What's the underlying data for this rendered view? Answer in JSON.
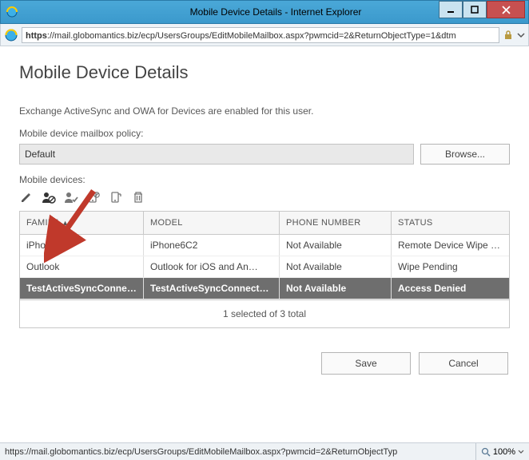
{
  "window": {
    "title": "Mobile Device Details - Internet Explorer",
    "url_display": "https://mail.globomantics.biz/ecp/UsersGroups/EditMobileMailbox.aspx?pwmcid=2&ReturnObjectType=1&dtm",
    "status_url": "https://mail.globomantics.biz/ecp/UsersGroups/EditMobileMailbox.aspx?pwmcid=2&ReturnObjectTyp",
    "zoom": "100%"
  },
  "page": {
    "title": "Mobile Device Details",
    "info_text": "Exchange ActiveSync and OWA for Devices are enabled for this user.",
    "policy_label": "Mobile device mailbox policy:",
    "policy_value": "Default",
    "browse_label": "Browse...",
    "devices_label": "Mobile devices:",
    "selection_text": "1 selected of 3 total",
    "save_label": "Save",
    "cancel_label": "Cancel"
  },
  "columns": {
    "family": "FAMILY",
    "model": "MODEL",
    "phone": "PHONE NUMBER",
    "status": "STATUS"
  },
  "rows": [
    {
      "family": "iPhone",
      "model": "iPhone6C2",
      "phone": "Not Available",
      "status": "Remote Device Wipe Su…",
      "selected": false
    },
    {
      "family": "Outlook",
      "model": "Outlook for iOS and An…",
      "phone": "Not Available",
      "status": "Wipe Pending",
      "selected": false
    },
    {
      "family": "TestActiveSyncConnect…",
      "model": "TestActiveSyncConnect…",
      "phone": "Not Available",
      "status": "Access Denied",
      "selected": true
    }
  ]
}
